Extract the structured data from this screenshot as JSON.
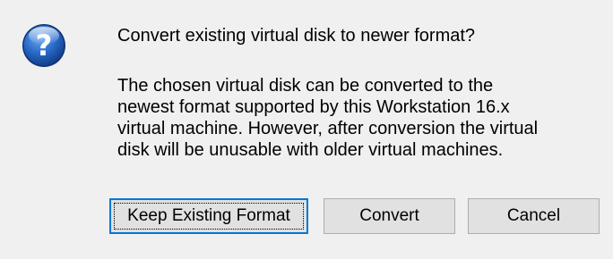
{
  "dialog": {
    "icon": "question-icon",
    "heading": "Convert existing virtual disk to newer format?",
    "body_lines": [
      "The chosen virtual disk can be converted to the",
      "newest format supported by this Workstation 16.x",
      "virtual machine.  However, after conversion the virtual",
      "disk will be unusable with older virtual machines."
    ],
    "buttons": {
      "keep_label": "Keep Existing Format",
      "convert_label": "Convert",
      "cancel_label": "Cancel"
    },
    "colors": {
      "background": "#f0f0f0",
      "button_face": "#e1e1e1",
      "button_border": "#adadad",
      "focus_border": "#0078d7",
      "icon_blue": "#1e5fb4"
    }
  }
}
